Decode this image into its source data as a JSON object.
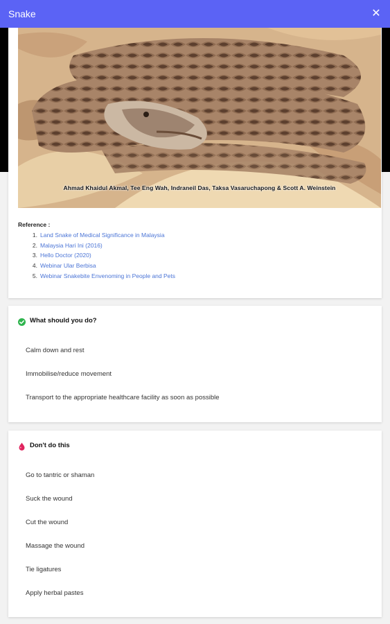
{
  "app": {
    "title": "Snake",
    "close_icon": "close-icon"
  },
  "photo": {
    "caption": "Ahmad Khaidul Akmal, Tee Eng Wah, Indraneil Das, Taksa Vasaruchapong & Scott A. Weinstein"
  },
  "references": {
    "title": "Reference :",
    "items": [
      {
        "num": "1.",
        "label": "Land Snake of Medical Significance in Malaysia"
      },
      {
        "num": "2.",
        "label": "Malaysia Hari Ini (2016)"
      },
      {
        "num": "3.",
        "label": "Hello Doctor (2020)"
      },
      {
        "num": "4.",
        "label": "Webinar Ular Berbisa"
      },
      {
        "num": "5.",
        "label": "Webinar Snakebite Envenoming in People and Pets"
      }
    ]
  },
  "do_section": {
    "title": "What should you do?",
    "icon": "check-circle-icon",
    "items": [
      "Calm down and rest",
      "Immobilise/reduce movement",
      "Transport to the appropriate healthcare facility as soon as possible"
    ]
  },
  "dont_section": {
    "title": "Don't do this",
    "icon": "blood-drop-icon",
    "items": [
      "Go to tantric or shaman",
      "Suck the wound",
      "Cut the wound",
      "Massage the wound",
      "Tie ligatures",
      "Apply herbal pastes"
    ]
  },
  "colors": {
    "appbar": "#5b63f5",
    "link": "#4a74d6",
    "check": "#2fb44e",
    "drop": "#e0245e"
  }
}
